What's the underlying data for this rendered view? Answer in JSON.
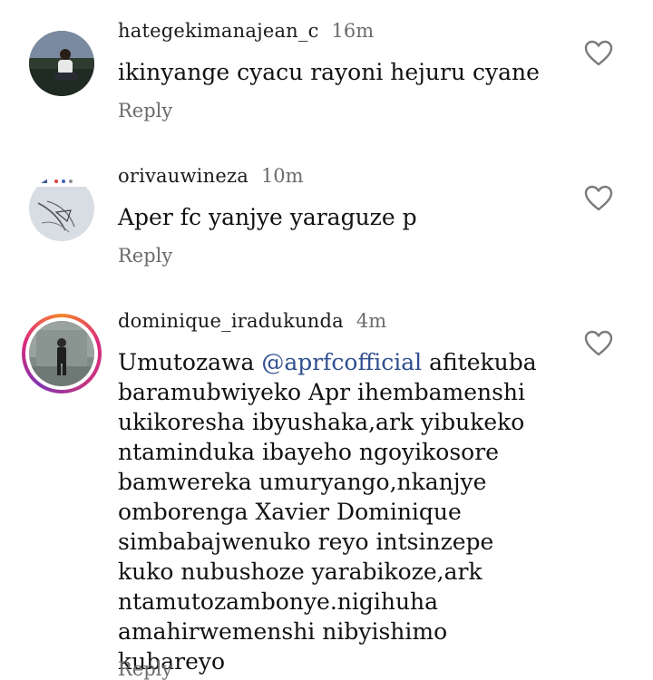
{
  "comments": [
    {
      "username": "hategekimanajean_c",
      "time": "16m",
      "text_lines": [
        "ikinyange cyacu rayoni hejuru cyane"
      ],
      "reply_label": "Reply",
      "avatar_icon": "person-photo",
      "like_icon": "heart-outline-icon"
    },
    {
      "username": "orivauwineza",
      "time": "10m",
      "text_lines": [
        "Aper fc yanjye yaraguze p"
      ],
      "reply_label": "Reply",
      "avatar_icon": "sketch-photo",
      "like_icon": "heart-outline-icon"
    },
    {
      "username": "dominique_iradukunda",
      "time": "4m",
      "text_prefix": "Umutozawa ",
      "mention": "@aprfcofficial",
      "text_first_suffix": " afitekuba",
      "text_lines": [
        "baramubwiyeko Apr ihembamenshi",
        "ukikoresha ibyushaka,ark yibukeko",
        "ntaminduka ibayeho ngoyikosore",
        "bamwereka umuryango,nkanjye",
        "omborenga Xavier Dominique",
        "simbabajwenuko reyo intsinzepe",
        "kuko nubushoze yarabikoze,ark",
        "ntamutozambonye.nigihuha",
        "amahirwemenshi nibyishimo kubareyo"
      ],
      "reply_label": "Reply",
      "avatar_icon": "story-ring-photo",
      "like_icon": "heart-outline-icon"
    }
  ],
  "colors": {
    "text": "#111111",
    "muted": "#6b6b6b",
    "mention": "#2f4f8f"
  }
}
